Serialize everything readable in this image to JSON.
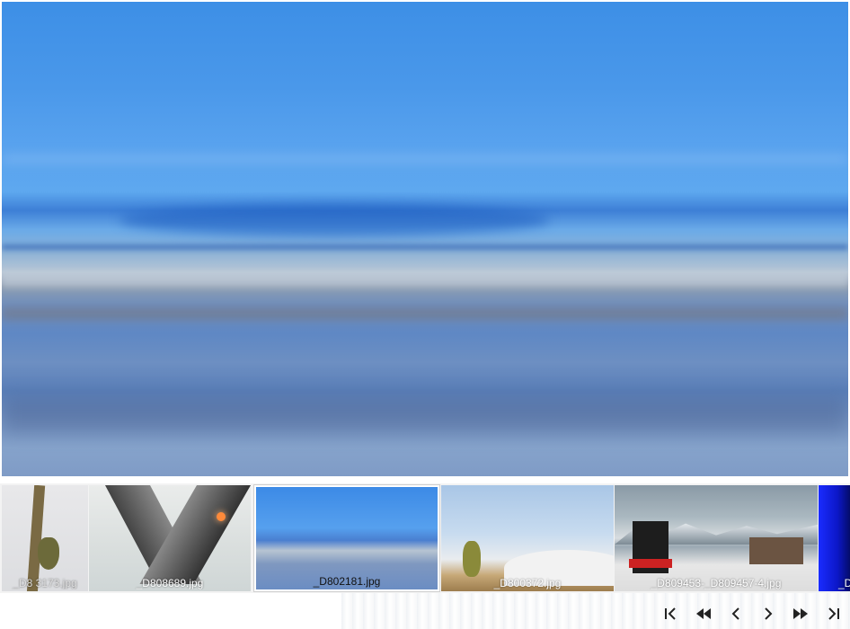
{
  "viewer": {
    "current_image": "_D802181.jpg"
  },
  "thumbnails": [
    {
      "caption": "_D8  3173.jpg",
      "active": false
    },
    {
      "caption": "_D808689.jpg",
      "active": false
    },
    {
      "caption": "_D802181.jpg",
      "active": true
    },
    {
      "caption": "_D800372.jpg",
      "active": false
    },
    {
      "caption": "_D809453-_D809457-4.jpg",
      "active": false
    },
    {
      "caption": "_D",
      "active": false
    }
  ],
  "controls": {
    "first": "first-icon",
    "rewind": "rewind-icon",
    "previous": "previous-icon",
    "next": "next-icon",
    "fast_forward": "fast-forward-icon",
    "last": "last-icon"
  },
  "colors": {
    "viewer_sky": "#4a98ea",
    "active_border": "#ffffff",
    "icon": "#222222"
  }
}
